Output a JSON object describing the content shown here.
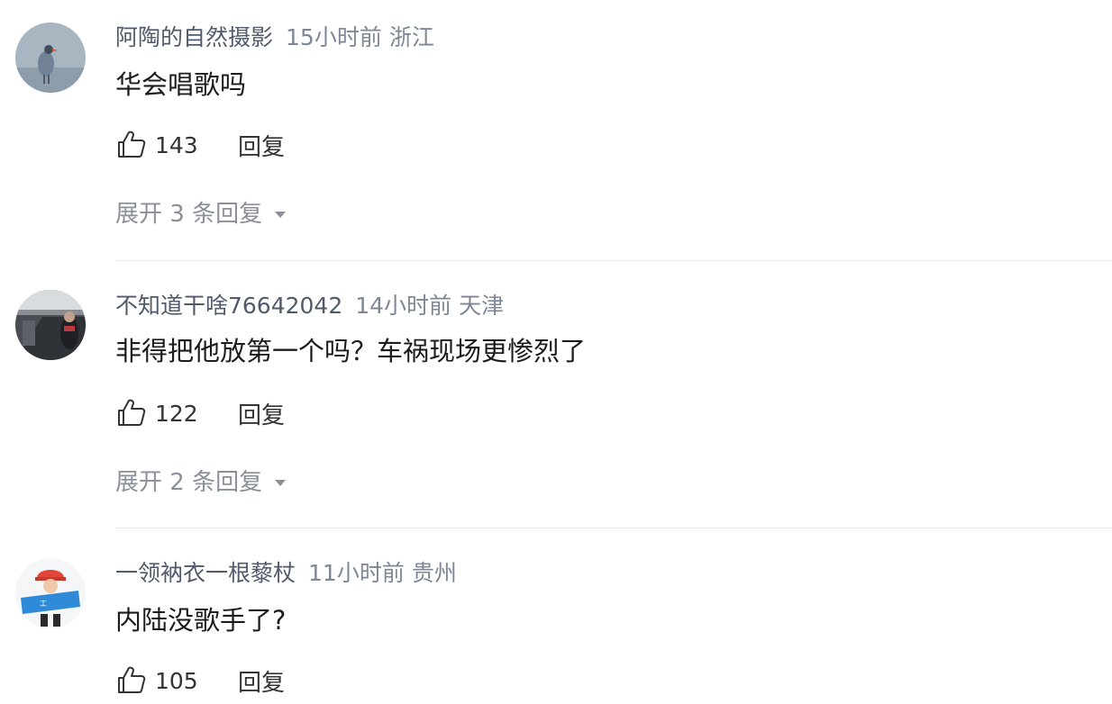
{
  "comments": [
    {
      "username": "阿陶的自然摄影",
      "time": "15小时前",
      "location": "浙江",
      "content": "华会唱歌吗",
      "likes": "143",
      "reply_label": "回复",
      "expand_label": "展开 3 条回复",
      "avatar_icon": "bird-photo-avatar"
    },
    {
      "username": "不知道干啥76642042",
      "time": "14小时前",
      "location": "天津",
      "content": "非得把他放第一个吗？车祸现场更惨烈了",
      "likes": "122",
      "reply_label": "回复",
      "expand_label": "展开 2 条回复",
      "avatar_icon": "subway-photo-avatar"
    },
    {
      "username": "一领衲衣一根藜杖",
      "time": "11小时前",
      "location": "贵州",
      "content": "内陆没歌手了?",
      "likes": "105",
      "reply_label": "回复",
      "avatar_icon": "worker-cartoon-avatar"
    }
  ],
  "colors": {
    "username": "#505a6b",
    "meta": "#7d8796",
    "content": "#1c1c1c",
    "expand": "#8a8f99",
    "divider": "#ececec"
  }
}
